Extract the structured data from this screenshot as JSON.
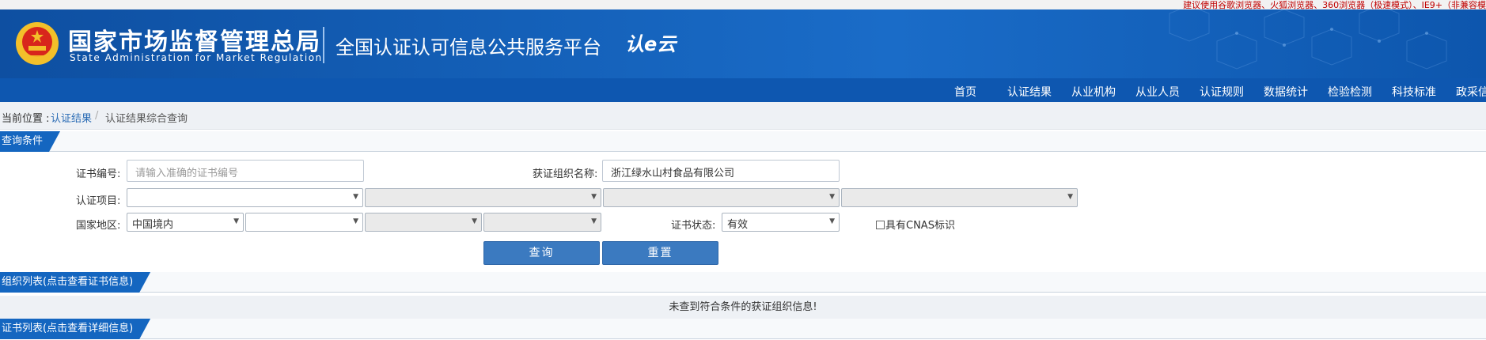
{
  "top_notice": "建议使用谷歌浏览器、火狐浏览器、360浏览器（极速模式）、IE9+（非兼容模",
  "header": {
    "org_name_cn": "国家市场监督管理总局",
    "org_name_en": "State Administration  for  Market Regulation",
    "platform_name": "全国认证认可信息公共服务平台",
    "brand_logo": "认e云"
  },
  "nav": {
    "items": [
      "首页",
      "认证结果",
      "从业机构",
      "从业人员",
      "认证规则",
      "数据统计",
      "检验检测",
      "科技标准",
      "政采信"
    ]
  },
  "breadcrumb": {
    "prefix": "当前位置 :",
    "link": "认证结果",
    "separator": "/",
    "current": "认证结果综合查询"
  },
  "query_section": {
    "title": "查询条件",
    "cert_no_label": "证书编号:",
    "cert_no_placeholder": "请输入准确的证书编号",
    "org_name_label": "获证组织名称:",
    "org_name_value": "浙江绿水山村食品有限公司",
    "cert_project_label": "认证项目:",
    "country_label": "国家地区:",
    "country_value": "中国境内",
    "cert_status_label": "证书状态:",
    "cert_status_value": "有效",
    "cnas_label": "具有CNAS标识",
    "query_button": "查询",
    "reset_button": "重置"
  },
  "org_list": {
    "title": "组织列表(点击查看证书信息)",
    "empty_message": "未查到符合条件的获证组织信息!"
  },
  "cert_list": {
    "title": "证书列表(点击查看详细信息)"
  },
  "colors": {
    "header_blue": "#1460b8",
    "nav_blue": "#0e57b0",
    "tab_blue": "#1466c0",
    "button_blue": "#3b7ac0",
    "notice_red": "#c00000"
  }
}
